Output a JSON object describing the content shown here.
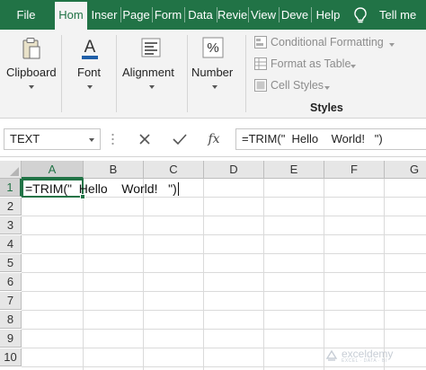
{
  "tabs": [
    {
      "label": "File",
      "active": false
    },
    {
      "label": "Hom",
      "active": true
    },
    {
      "label": "Inser",
      "active": false
    },
    {
      "label": "Page",
      "active": false
    },
    {
      "label": "Form",
      "active": false
    },
    {
      "label": "Data",
      "active": false
    },
    {
      "label": "Revie",
      "active": false
    },
    {
      "label": "View",
      "active": false
    },
    {
      "label": "Deve",
      "active": false
    },
    {
      "label": "Help",
      "active": false
    }
  ],
  "tell_me": "Tell me",
  "ribbon": {
    "clipboard": "Clipboard",
    "font": "Font",
    "alignment": "Alignment",
    "number": "Number",
    "number_icon": "%",
    "font_icon": "A",
    "conditional_formatting": "Conditional Formatting",
    "format_as_table": "Format as Table",
    "cell_styles": "Cell Styles",
    "styles": "Styles"
  },
  "formula_bar": {
    "name_box": "TEXT",
    "fx": "fx",
    "formula": "=TRIM(\"  Hello    World!   \")"
  },
  "grid": {
    "columns": [
      "A",
      "B",
      "C",
      "D",
      "E",
      "F",
      "G"
    ],
    "rows": [
      "1",
      "2",
      "3",
      "4",
      "5",
      "6",
      "7",
      "8",
      "9",
      "10"
    ],
    "active_cell": "A1",
    "cell_a1": "=TRIM(\"  Hello    World!   \")"
  },
  "watermark": {
    "name": "exceldemy",
    "tagline": "EXCEL · DATA · BI"
  },
  "colors": {
    "accent": "#217346",
    "ribbon": "#f3f3f3"
  }
}
